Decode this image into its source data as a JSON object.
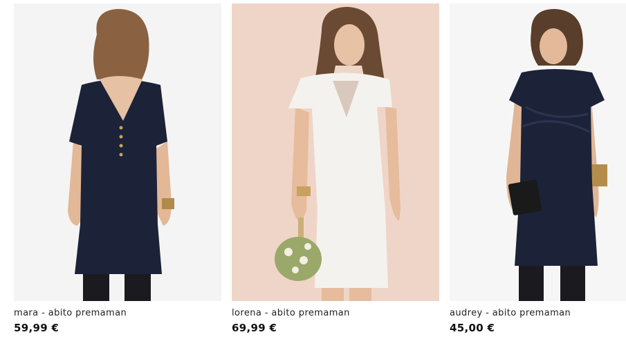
{
  "products": [
    {
      "name": "mara - abito premaman",
      "price": "59,99 €"
    },
    {
      "name": "lorena - abito premaman",
      "price": "69,99 €"
    },
    {
      "name": "audrey - abito premaman",
      "price": "45,00 €"
    }
  ],
  "colors": {
    "navy_dress": "#1c2338",
    "white_dress": "#f4f2ee",
    "blush_background": "#efd5c8",
    "light_background": "#f4f4f4"
  }
}
